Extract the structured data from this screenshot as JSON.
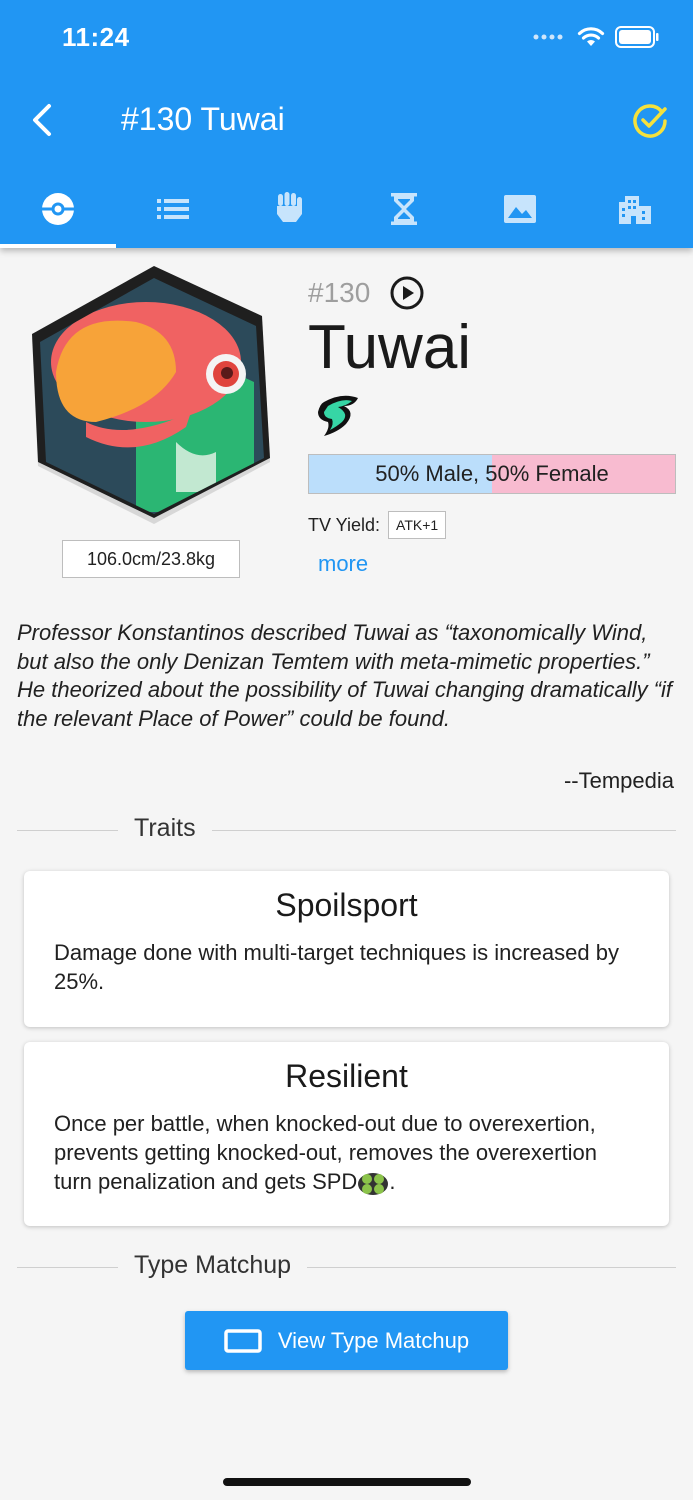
{
  "status_bar": {
    "time": "11:24"
  },
  "app_bar": {
    "title": "#130 Tuwai",
    "back_icon": "chevron-left-icon",
    "check_icon": "check-circle-icon",
    "check_color": "#f5e13c"
  },
  "tabs": [
    {
      "icon": "temcard-icon",
      "active": true
    },
    {
      "icon": "list-icon",
      "active": false
    },
    {
      "icon": "fist-icon",
      "active": false
    },
    {
      "icon": "hourglass-icon",
      "active": false
    },
    {
      "icon": "image-icon",
      "active": false
    },
    {
      "icon": "location-icon",
      "active": false
    }
  ],
  "temtem": {
    "number": "#130",
    "name": "Tuwai",
    "size": "106.0cm/23.8kg",
    "gender_label": "50% Male, 50% Female",
    "gender_male_pct": 50,
    "tv_yield_label": "TV Yield:",
    "tv_yield_value": "ATK+1",
    "more_label": "more",
    "type_icon": "wind-type-icon"
  },
  "description": {
    "text": "Professor Konstantinos described Tuwai as “taxonomically Wind, but also the only Denizan Temtem with meta-mimetic properties.” He theorized about the possibility of Tuwai changing dramatically “if the relevant Place of Power” could be found.",
    "source": "--Tempedia"
  },
  "traits_section": {
    "title": "Traits",
    "traits": [
      {
        "name": "Spoilsport",
        "description": "Damage done with multi-target techniques is increased by 25%."
      },
      {
        "name": "Resilient",
        "description": "Once per battle, when knocked-out due to overexertion, prevents getting knocked-out, removes the overexertion turn penalization and gets SPD",
        "suffix": "."
      }
    ]
  },
  "type_matchup_section": {
    "title": "Type Matchup",
    "button_label": "View Type Matchup"
  },
  "colors": {
    "primary": "#2196f3",
    "male": "#bbdefb",
    "female": "#f8bbd0",
    "link": "#2196f3"
  }
}
